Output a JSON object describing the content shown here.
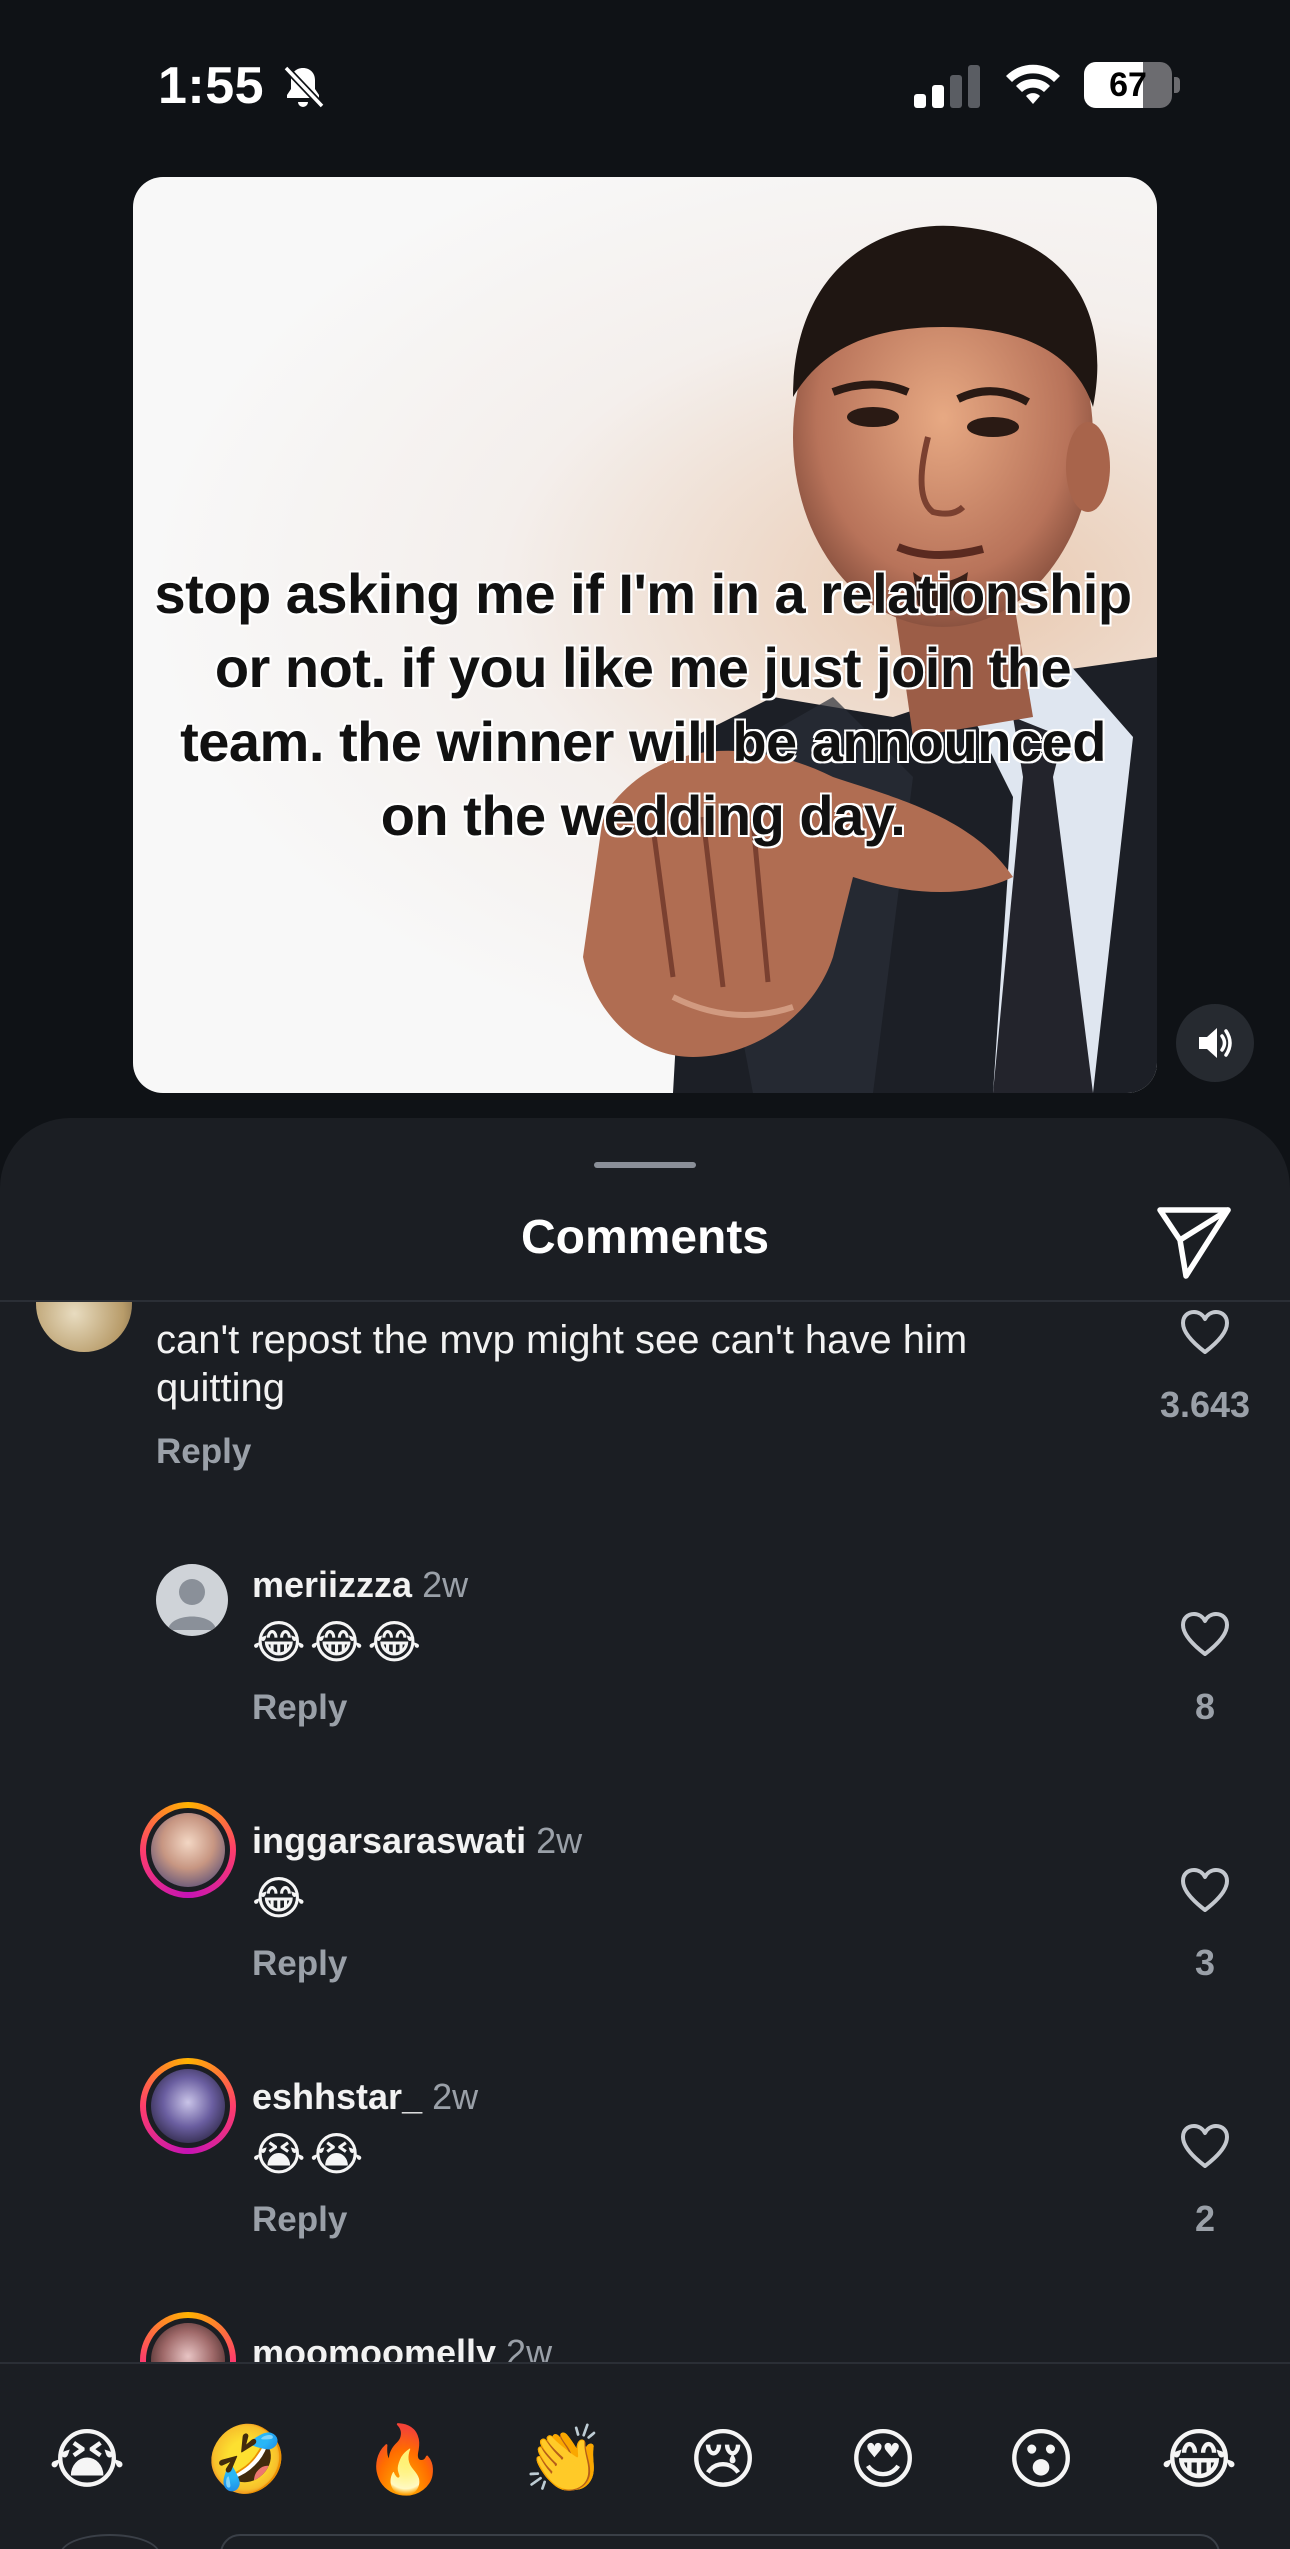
{
  "status_bar": {
    "time": "1:55",
    "battery_level": "67",
    "battery_fraction": 0.67
  },
  "post": {
    "caption": "stop asking me if I'm in a relationship or not. if you like me just join the team. the winner will be announced on the wedding day."
  },
  "sheet": {
    "title": "Comments"
  },
  "comments": [
    {
      "text": "can't repost the mvp might see can't have him quitting",
      "reply_label": "Reply",
      "likes": "3.643"
    },
    {
      "username": "meriizzza",
      "time": "2w",
      "emoji": "😂😂😂",
      "reply_label": "Reply",
      "likes": "8"
    },
    {
      "username": "inggarsaraswati",
      "time": "2w",
      "emoji": "😂",
      "reply_label": "Reply",
      "likes": "3"
    },
    {
      "username": "eshhstar_",
      "time": "2w",
      "emoji": "😭😭",
      "reply_label": "Reply",
      "likes": "2"
    },
    {
      "username": "moomoomelly",
      "time": "2w"
    }
  ],
  "emoji_bar": [
    "😭",
    "🤣",
    "🔥",
    "👏",
    "😢",
    "😍",
    "😮",
    "😂"
  ],
  "icons": {
    "bell": "bell-slash-icon",
    "signal": "cellular-signal-icon",
    "wifi": "wifi-icon",
    "volume": "speaker-icon",
    "share": "paper-plane-icon",
    "like": "heart-outline-icon"
  },
  "colors": {
    "background": "#0f1216",
    "sheet": "#1b1e23",
    "muted_text": "#9aa0a8",
    "story_ring": "#ff3d6b"
  }
}
